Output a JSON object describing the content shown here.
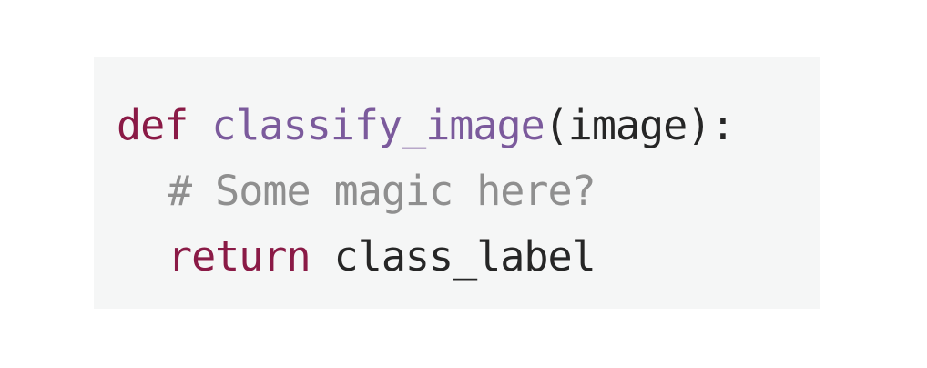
{
  "code": {
    "line1": {
      "keyword": "def",
      "function_name": "classify_image",
      "signature": "(image):"
    },
    "line2": {
      "comment": "# Some magic here?"
    },
    "line3": {
      "keyword": "return",
      "value": "class_label"
    }
  },
  "colors": {
    "background": "#f5f6f6",
    "keyword": "#8a1a46",
    "function": "#7b5a9c",
    "text": "#262626",
    "comment": "#8f8f8f"
  }
}
